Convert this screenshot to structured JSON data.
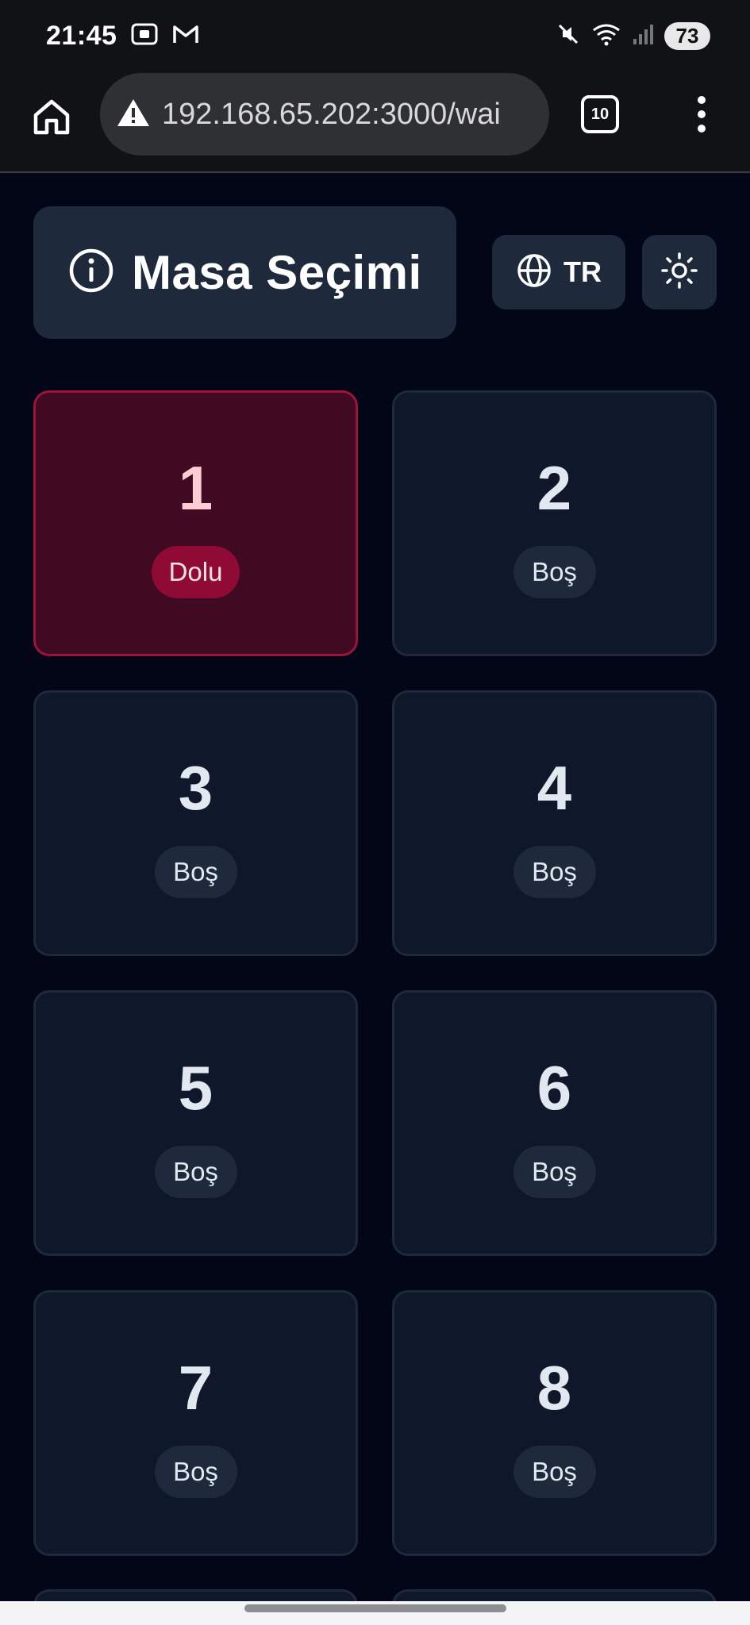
{
  "status_bar": {
    "time": "21:45",
    "battery": "73"
  },
  "browser": {
    "url": "192.168.65.202:3000/wai",
    "tab_count": "10"
  },
  "header": {
    "title": "Masa Seçimi",
    "language_label": "TR"
  },
  "tables": [
    {
      "number": "1",
      "status": "Dolu"
    },
    {
      "number": "2",
      "status": "Boş"
    },
    {
      "number": "3",
      "status": "Boş"
    },
    {
      "number": "4",
      "status": "Boş"
    },
    {
      "number": "5",
      "status": "Boş"
    },
    {
      "number": "6",
      "status": "Boş"
    },
    {
      "number": "7",
      "status": "Boş"
    },
    {
      "number": "8",
      "status": "Boş"
    }
  ],
  "colors": {
    "occupied_accent": "#9f1239",
    "free_card": "#0f172a",
    "background": "#020617"
  }
}
